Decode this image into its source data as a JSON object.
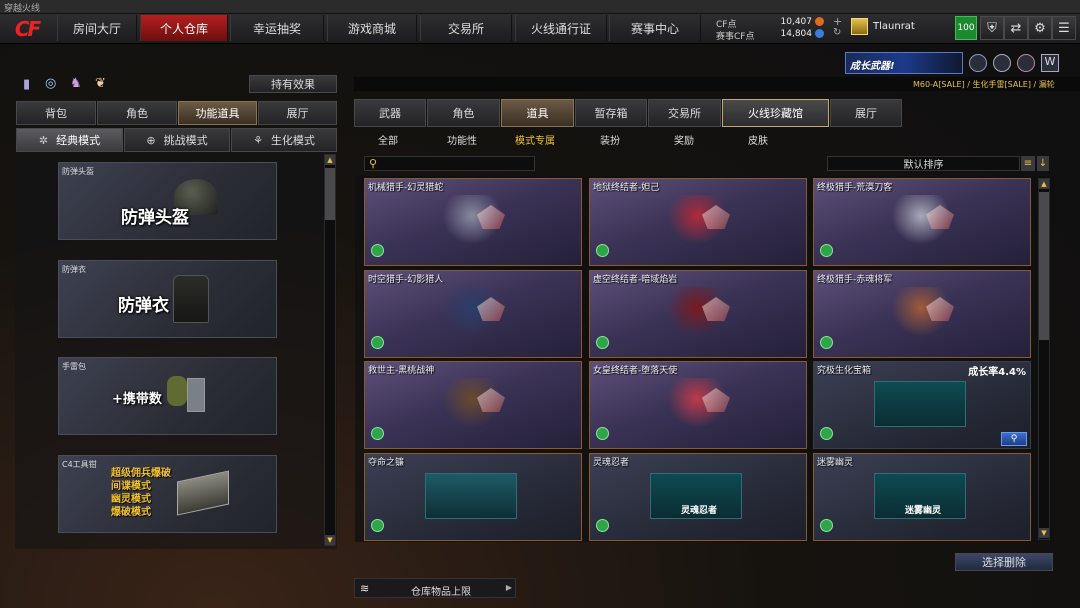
{
  "window": {
    "title": "穿越火线"
  },
  "logo": {
    "text": "CF"
  },
  "nav": {
    "tabs": [
      "房间大厅",
      "个人仓库",
      "幸运抽奖",
      "游戏商城",
      "交易所",
      "火线通行证",
      "赛事中心"
    ],
    "active": 1
  },
  "currency": {
    "cf_label": "CF点",
    "cf_value": "10,407",
    "match_label": "赛事CF点",
    "match_value": "14,804"
  },
  "user": {
    "name": "Tlaunrat",
    "level": "100"
  },
  "banner": {
    "text": "成长武器!",
    "ticker": "M60-A[SALE] / 生化手雷[SALE] / 漏轮"
  },
  "left": {
    "effects_button": "持有效果",
    "tabs": [
      "背包",
      "角色",
      "功能道具",
      "展厅"
    ],
    "active_tab": 2,
    "modes": [
      "经典模式",
      "挑战模式",
      "生化模式"
    ],
    "active_mode": 0,
    "items": [
      {
        "label": "防弹头盔",
        "title": "防弹头盔"
      },
      {
        "label": "防弹衣",
        "title": "防弹衣"
      },
      {
        "label": "手雷包",
        "title": "+携带数"
      },
      {
        "label": "C4工具钳",
        "lines": [
          "超级佣兵爆破",
          "间谍模式",
          "幽灵模式",
          "爆破模式"
        ]
      }
    ]
  },
  "right": {
    "tabs": [
      "武器",
      "角色",
      "道具",
      "暂存箱",
      "交易所",
      "火线珍藏馆",
      "展厅"
    ],
    "active_tab": 5,
    "subtabs": [
      "全部",
      "功能性",
      "模式专属",
      "装扮",
      "奖励",
      "皮肤"
    ],
    "active_subtab": 2,
    "search_placeholder": "",
    "sort_label": "默认排序",
    "cards": [
      {
        "name": "机械猎手-幻灵猎蛇",
        "style": "purple"
      },
      {
        "name": "地狱终结者-妲己",
        "style": "purple"
      },
      {
        "name": "终极猎手-荒漠刀客",
        "style": "purple"
      },
      {
        "name": "时空猎手-幻影猎人",
        "style": "purple"
      },
      {
        "name": "虚空终结者-暗域焰岩",
        "style": "purple"
      },
      {
        "name": "终极猎手-赤魂将军",
        "style": "purple"
      },
      {
        "name": "救世主-黑桃战神",
        "style": "purple"
      },
      {
        "name": "女皇终结者-堕落天使",
        "style": "purple"
      },
      {
        "name": "究极生化宝箱",
        "style": "gray",
        "rate": "成长率4.4%"
      },
      {
        "name": "夺命之镰",
        "style": "gray"
      },
      {
        "name": "灵魂忍者",
        "style": "gray",
        "caption": "灵魂忍者"
      },
      {
        "name": "迷雾幽灵",
        "style": "gray",
        "caption": "迷雾幽灵"
      }
    ],
    "delete_button": "选择删除",
    "storage_label": "仓库物品上限"
  },
  "colors": {
    "accent_red": "#b52020",
    "card_border": "#8a5a2a",
    "tag_green": "#2da548"
  }
}
